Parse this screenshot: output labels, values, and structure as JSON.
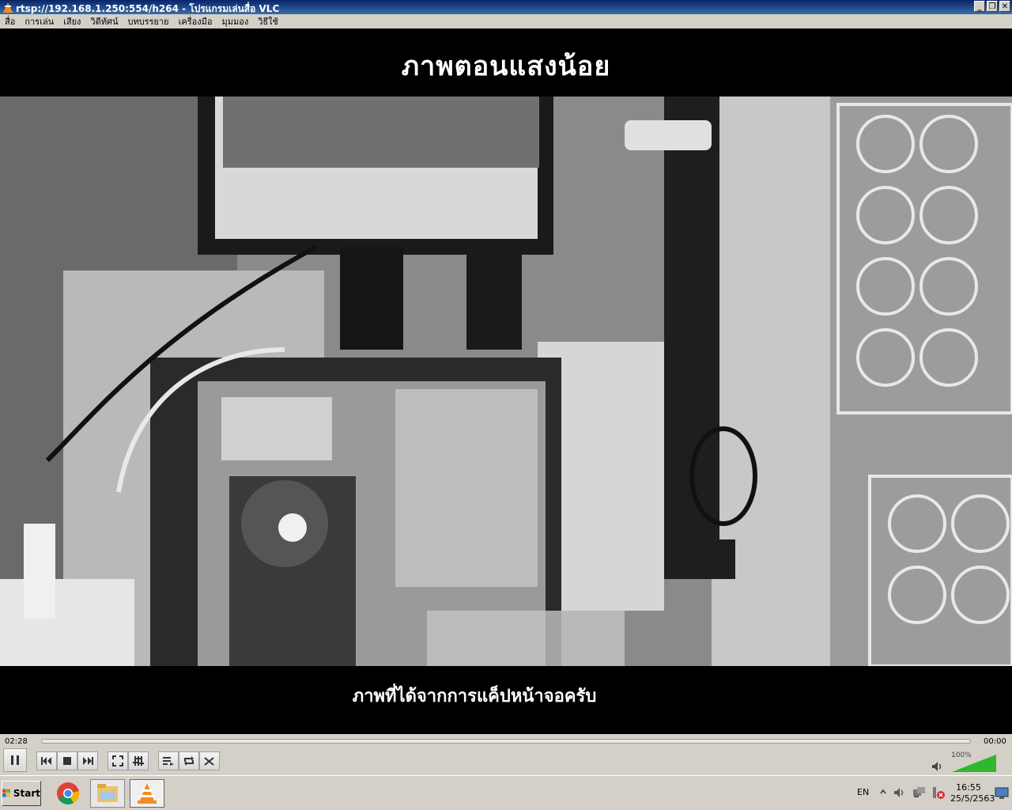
{
  "window": {
    "title": "rtsp://192.168.1.250:554/h264 - โปรแกรมเล่นสื่อ VLC",
    "buttons": [
      "minimize",
      "restore",
      "close"
    ]
  },
  "menu": [
    "สื่อ",
    "การเล่น",
    "เสียง",
    "วิดีทัศน์",
    "บทบรรยาย",
    "เครื่องมือ",
    "มุมมอง",
    "วิธีใช้"
  ],
  "video": {
    "caption_top": "ภาพตอนแสงน้อย",
    "caption_bottom": "ภาพที่ได้จากการแค็ปหน้าจอครับ"
  },
  "controls": {
    "time_elapsed": "02:28",
    "time_total": "00:00",
    "volume": "100%",
    "volume_level": 1.0,
    "buttons": [
      "pause",
      "previous",
      "stop",
      "next",
      "fullscreen",
      "extended-settings",
      "playlist",
      "loop",
      "random"
    ]
  },
  "taskbar": {
    "start": "Start",
    "apps": [
      "chrome-icon",
      "file-explorer-icon",
      "vlc-icon"
    ],
    "language": "EN",
    "clock_time": "16:55",
    "clock_date": "25/5/2563"
  }
}
